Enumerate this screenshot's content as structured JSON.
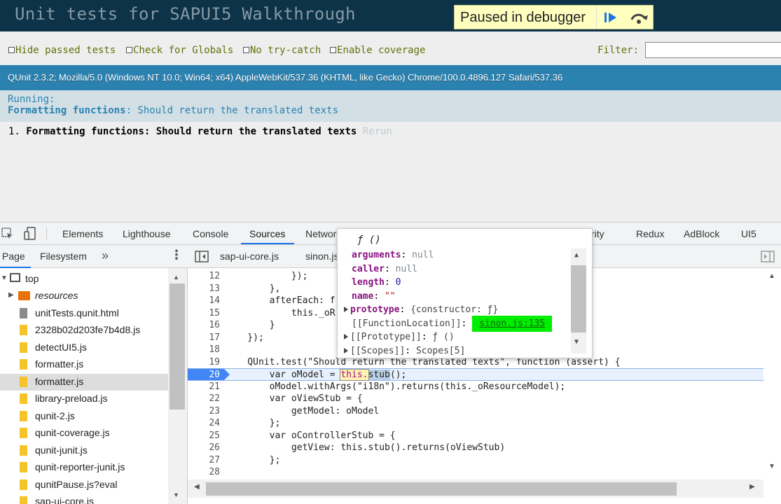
{
  "header": {
    "title": "Unit tests for SAPUI5 Walkthrough",
    "debugger": {
      "label": "Paused in debugger",
      "resume_icon": "resume-icon",
      "step_over_icon": "step-over-icon"
    }
  },
  "toolbar": {
    "options": [
      "Hide passed tests",
      "Check for Globals",
      "No try-catch",
      "Enable coverage"
    ],
    "filter_label": "Filter:",
    "filter_value": ""
  },
  "user_agent": "QUnit 2.3.2; Mozilla/5.0 (Windows NT 10.0; Win64; x64) AppleWebKit/537.36 (KHTML, like Gecko) Chrome/100.0.4896.127 Safari/537.36",
  "test_result": {
    "running_label": "Running:",
    "module": "Formatting functions",
    "test": ": Should return the translated texts"
  },
  "tests": [
    {
      "index": "1.",
      "name": "Formatting functions: Should return the translated texts",
      "rerun": "Rerun"
    }
  ],
  "devtools": {
    "tabs": [
      "Elements",
      "Lighthouse",
      "Console",
      "Sources",
      "Network",
      "rity",
      "Redux",
      "AdBlock",
      "UI5"
    ],
    "active_tab": "Sources",
    "navigator_tabs": [
      "Page",
      "Filesystem"
    ],
    "tree": [
      {
        "label": "top",
        "type": "frame"
      },
      {
        "label": "resources",
        "type": "folder"
      },
      {
        "label": "unitTests.qunit.html",
        "type": "html"
      },
      {
        "label": "2328b02d203fe7b4d8.js",
        "type": "js"
      },
      {
        "label": "detectUI5.js",
        "type": "js"
      },
      {
        "label": "formatter.js",
        "type": "js"
      },
      {
        "label": "formatter.js",
        "type": "js",
        "selected": true
      },
      {
        "label": "library-preload.js",
        "type": "js"
      },
      {
        "label": "qunit-2.js",
        "type": "js"
      },
      {
        "label": "qunit-coverage.js",
        "type": "js"
      },
      {
        "label": "qunit-junit.js",
        "type": "js"
      },
      {
        "label": "qunit-reporter-junit.js",
        "type": "js"
      },
      {
        "label": "qunitPause.js?eval",
        "type": "js"
      },
      {
        "label": "sap-ui-core.js",
        "type": "js"
      }
    ],
    "editor_tabs": [
      "sap-ui-core.js",
      "sinon.js"
    ],
    "code_lines": [
      {
        "n": "12",
        "text": "            });"
      },
      {
        "n": "13",
        "text": "        },"
      },
      {
        "n": "14",
        "text": "        afterEach: f"
      },
      {
        "n": "15",
        "text": "            this._oR"
      },
      {
        "n": "16",
        "text": "        }"
      },
      {
        "n": "17",
        "text": "    });"
      },
      {
        "n": "18",
        "text": ""
      },
      {
        "n": "19",
        "text": "    QUnit.test(\"Should return the translated texts\", function (assert) {"
      },
      {
        "n": "20",
        "text": "        var oModel = this.stub();"
      },
      {
        "n": "21",
        "text": "        oModel.withArgs(\"i18n\").returns(this._oResourceModel);"
      },
      {
        "n": "22",
        "text": "        var oViewStub = {"
      },
      {
        "n": "23",
        "text": "            getModel: oModel"
      },
      {
        "n": "24",
        "text": "        };"
      },
      {
        "n": "25",
        "text": "        var oControllerStub = {"
      },
      {
        "n": "26",
        "text": "            getView: this.stub().returns(oViewStub)"
      },
      {
        "n": "27",
        "text": "        };"
      },
      {
        "n": "28",
        "text": ""
      }
    ],
    "popover": {
      "title": "ƒ ()",
      "properties": [
        {
          "name": "arguments",
          "value": "null",
          "kind": "null"
        },
        {
          "name": "caller",
          "value": "null",
          "kind": "null"
        },
        {
          "name": "length",
          "value": "0",
          "kind": "num"
        },
        {
          "name": "name",
          "value": "\"\"",
          "kind": "str"
        },
        {
          "name": "prototype",
          "value": "{constructor: ƒ}",
          "kind": "obj",
          "expandable": true
        },
        {
          "name": "[[FunctionLocation]]",
          "value": "sinon.js:135",
          "kind": "link"
        },
        {
          "name": "[[Prototype]]",
          "value": "ƒ ()",
          "kind": "obj",
          "expandable": true
        },
        {
          "name": "[[Scopes]]",
          "value": "Scopes[5]",
          "kind": "obj",
          "expandable": true
        }
      ]
    }
  }
}
